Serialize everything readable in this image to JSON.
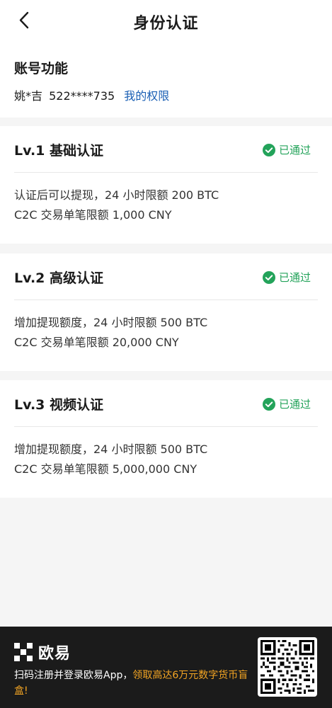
{
  "header": {
    "title": "身份认证",
    "back_icon": "chevron-left-icon"
  },
  "account": {
    "heading": "账号功能",
    "user_name": "姚*吉",
    "phone": "522****735",
    "permissions_link": "我的权限"
  },
  "levels": [
    {
      "title": "Lv.1 基础认证",
      "status": "已通过",
      "lines": [
        "认证后可以提现，24 小时限额 200 BTC",
        "C2C 交易单笔限额 1,000 CNY"
      ]
    },
    {
      "title": "Lv.2 高级认证",
      "status": "已通过",
      "lines": [
        "增加提现额度，24 小时限额 500 BTC",
        "C2C 交易单笔限额 20,000 CNY"
      ]
    },
    {
      "title": "Lv.3 视频认证",
      "status": "已通过",
      "lines": [
        "增加提现额度，24 小时限额 500 BTC",
        "C2C 交易单笔限额 5,000,000 CNY"
      ]
    }
  ],
  "promo": {
    "logo_text": "欧易",
    "text_prefix": "扫码注册并登录欧易App，",
    "text_highlight": "领取高达6万元数字货币盲盒!"
  },
  "colors": {
    "status_green": "#23a35a",
    "link_blue": "#1a5fb4",
    "promo_highlight": "#f5a623",
    "promo_bg": "#1b1b1b"
  }
}
